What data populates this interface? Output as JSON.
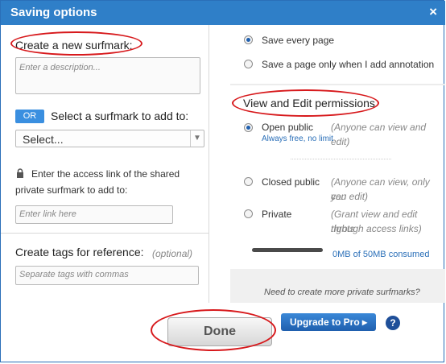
{
  "window": {
    "title": "Saving options",
    "close_glyph": "×"
  },
  "left": {
    "create_heading": "Create a new surfmark:",
    "description_placeholder": "Enter a description...",
    "or_label": "OR",
    "select_heading": "Select a surfmark to add to:",
    "select_value": "Select...",
    "access_text_line1": "Enter the access link of the shared",
    "access_text_line2": "private surfmark to add to:",
    "link_placeholder": "Enter link here",
    "tags_heading": "Create tags for reference:",
    "tags_optional": "(optional)",
    "tags_placeholder": "Separate tags with commas"
  },
  "right": {
    "save_every_page": "Save every page",
    "save_with_annotation": "Save a page only when I add annotation",
    "permissions_heading": "View and Edit permissions",
    "open_public": "Open public",
    "open_public_desc": "(Anyone can view and edit)",
    "always_free": "Always free, no limit",
    "closed_public": "Closed public",
    "closed_public_desc_line1": "(Anyone can view, only you",
    "closed_public_desc_line2": "can edit)",
    "private": "Private",
    "private_desc_line1": "(Grant view and edit rights",
    "private_desc_line2": "through access links)",
    "storage_consumed": "0MB of 50MB consumed",
    "storage_fraction": 0.0,
    "more_private_prompt": "Need to create more private surfmarks?"
  },
  "footer": {
    "done_label": "Done",
    "upgrade_label": "Upgrade to Pro ▸",
    "help_label": "?"
  },
  "colors": {
    "titlebar": "#2f7fc8",
    "annotation_red": "#d7191c",
    "link_blue": "#2a6fb8"
  },
  "icons": {
    "lock": "lock-icon",
    "close": "close-icon",
    "help": "help-icon",
    "dropdown": "chevron-down-icon"
  }
}
